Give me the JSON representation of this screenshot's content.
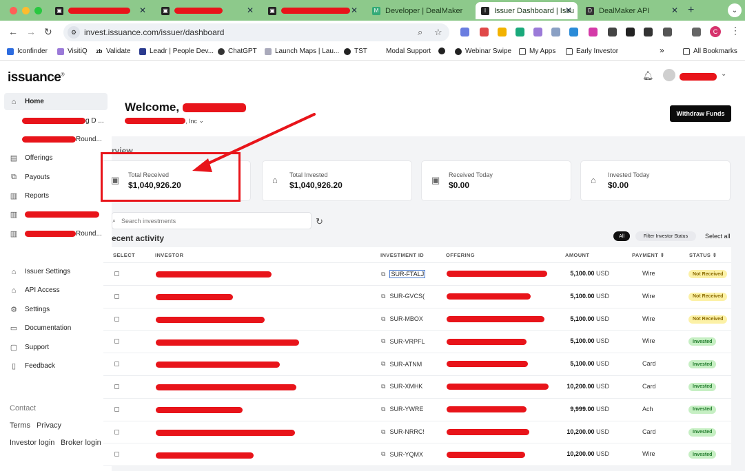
{
  "browser": {
    "tabs": [
      {
        "title": "",
        "redacted": true
      },
      {
        "title": "",
        "redacted": true
      },
      {
        "title": "",
        "redacted": true
      },
      {
        "title": "Developer | DealMaker"
      },
      {
        "title": "Issuer Dashboard | Issu",
        "active": true
      },
      {
        "title": "DealMaker API"
      }
    ],
    "new_tab": "+",
    "url": "invest.issuance.com/issuer/dashboard",
    "profile_initial": "C",
    "bookmarks": [
      "Iconfinder",
      "VisitiQ",
      "Validate",
      "Leadr | People Dev...",
      "ChatGPT",
      "Launch Maps | Lau...",
      "TST",
      "Modal Support",
      "Webinar Swipe",
      "My Apps",
      "Early Investor"
    ],
    "bookmarks_more": "»",
    "all_bookmarks": "All Bookmarks"
  },
  "sidebar": {
    "logo": "issuance",
    "logo_mark": "®",
    "home": "Home",
    "offering_suffix_1": "g D ...",
    "offering_suffix_2": "Round...",
    "offerings": "Offerings",
    "payouts": "Payouts",
    "reports": "Reports",
    "report_suffix_2": "Round...",
    "issuer_settings": "Issuer Settings",
    "api_access": "API Access",
    "settings": "Settings",
    "documentation": "Documentation",
    "support": "Support",
    "feedback": "Feedback",
    "footer": {
      "contact": "Contact",
      "terms": "Terms",
      "privacy": "Privacy",
      "investor_login": "Investor login",
      "broker_login": "Broker login"
    }
  },
  "header": {
    "welcome": "Welcome,",
    "company_suffix": ", Inc",
    "withdraw_button": "Withdraw Funds"
  },
  "overview": {
    "section_label": "rview",
    "cards": [
      {
        "label": "Total Received",
        "value": "$1,040,926.20",
        "icon": "cash-icon"
      },
      {
        "label": "Total Invested",
        "value": "$1,040,926.20",
        "icon": "bank-icon"
      },
      {
        "label": "Received Today",
        "value": "$0.00",
        "icon": "cash-icon"
      },
      {
        "label": "Invested Today",
        "value": "$0.00",
        "icon": "bank-icon"
      }
    ]
  },
  "activity": {
    "search_placeholder": "Search investments",
    "title": "ecent activity",
    "filter_all": "All",
    "filter_status": "Filter Investor Status",
    "select_all": "Select all",
    "columns": {
      "select": "SELECT",
      "investor": "INVESTOR",
      "investment_id": "INVESTMENT ID",
      "offering": "OFFERING",
      "amount": "AMOUNT",
      "payment": "PAYMENT ⇕",
      "status": "STATUS ⇕"
    },
    "rows": [
      {
        "id": "SUR-FTALJ",
        "amount": "5,100.00",
        "currency": "USD",
        "payment": "Wire",
        "status": "Not Received"
      },
      {
        "id": "SUR-GVCS(",
        "amount": "5,100.00",
        "currency": "USD",
        "payment": "Wire",
        "status": "Not Received"
      },
      {
        "id": "SUR-MBOX",
        "amount": "5,100.00",
        "currency": "USD",
        "payment": "Wire",
        "status": "Not Received"
      },
      {
        "id": "SUR-VRPFL",
        "amount": "5,100.00",
        "currency": "USD",
        "payment": "Wire",
        "status": "Invested"
      },
      {
        "id": "SUR-ATNM",
        "amount": "5,100.00",
        "currency": "USD",
        "payment": "Card",
        "status": "Invested"
      },
      {
        "id": "SUR-XMHK",
        "amount": "10,200.00",
        "currency": "USD",
        "payment": "Card",
        "status": "Invested"
      },
      {
        "id": "SUR-YWRE",
        "amount": "9,999.00",
        "currency": "USD",
        "payment": "Ach",
        "status": "Invested"
      },
      {
        "id": "SUR-NRRC!",
        "amount": "10,200.00",
        "currency": "USD",
        "payment": "Card",
        "status": "Invested"
      },
      {
        "id": "SUR-YQMX",
        "amount": "10,200.00",
        "currency": "USD",
        "payment": "Wire",
        "status": "Invested"
      }
    ]
  },
  "colors": {
    "tabbar": "#8dc98b",
    "annotation_red": "#e8141a",
    "withdraw_bg": "#0b0b0b",
    "invested_badge": "#c6efc3",
    "not_received_badge": "#fcf1a6"
  }
}
